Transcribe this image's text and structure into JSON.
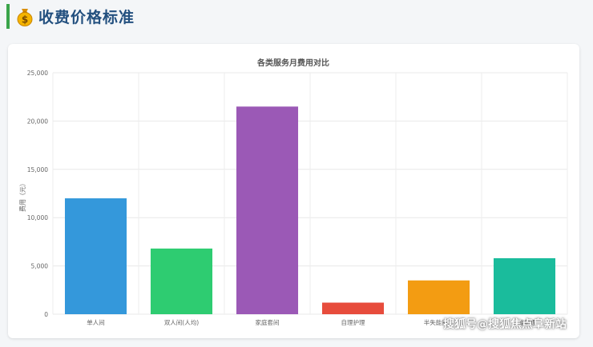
{
  "header": {
    "title": "收费价格标准",
    "icon": "money-bag-icon"
  },
  "watermark": "搜狐号@搜狐焦点阜新站",
  "chart_data": {
    "type": "bar",
    "title": "各类服务月费用对比",
    "xlabel": "",
    "ylabel": "费用（元）",
    "categories": [
      "单人间",
      "双人间(人均)",
      "家庭套间",
      "自理护理",
      "半失能护理",
      "失能护理"
    ],
    "values": [
      12000,
      6800,
      21500,
      1200,
      3500,
      5800
    ],
    "colors": [
      "#3498db",
      "#2ecc71",
      "#9b59b6",
      "#e74c3c",
      "#f39c12",
      "#1abc9c"
    ],
    "ylim": [
      0,
      25000
    ],
    "yticks": [
      0,
      5000,
      10000,
      15000,
      20000,
      25000
    ],
    "ytick_labels": [
      "0",
      "5,000",
      "10,000",
      "15,000",
      "20,000",
      "25,000"
    ],
    "grid": true,
    "legend": "none"
  }
}
